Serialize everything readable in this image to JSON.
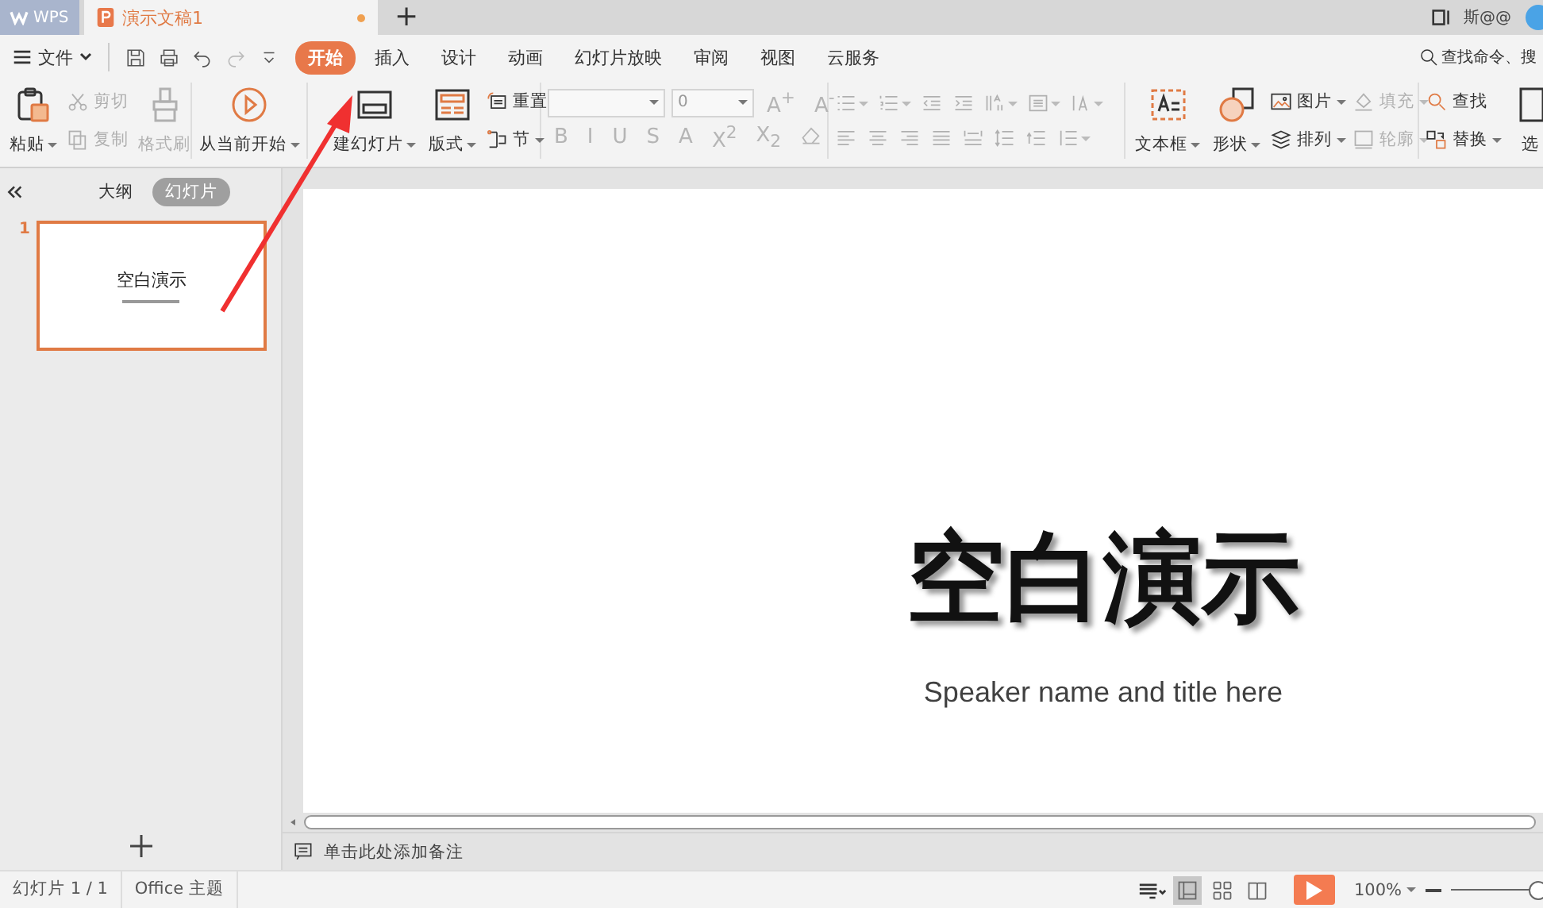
{
  "title_bar": {
    "app_tab": "WPS",
    "document_tab": {
      "title": "演示文稿1",
      "unsaved": true
    },
    "new_tab": "+",
    "user": "斯@@"
  },
  "menu_bar": {
    "file_menu": "文件",
    "quick_access": [
      {
        "disabled": false
      },
      {
        "disabled": false
      },
      {
        "disabled": false
      },
      {
        "disabled": true
      },
      {
        "disabled": false
      }
    ],
    "tabs": [
      {
        "label": "开始",
        "selected": true
      },
      {
        "label": "插入",
        "selected": false
      },
      {
        "label": "设计",
        "selected": false
      },
      {
        "label": "动画",
        "selected": false
      },
      {
        "label": "幻灯片放映",
        "selected": false
      },
      {
        "label": "审阅",
        "selected": false
      },
      {
        "label": "视图",
        "selected": false
      },
      {
        "label": "云服务",
        "selected": false
      }
    ],
    "search": {
      "placeholder": "查找命令、搜"
    }
  },
  "ribbon": {
    "groups": [
      {
        "items": [
          {
            "kind": "large",
            "label": "粘贴",
            "dropdown": true,
            "disabled": false
          },
          {
            "kind": "stack",
            "items": [
              {
                "label": "剪切",
                "dropdown": false,
                "disabled": true
              },
              {
                "label": "复制",
                "dropdown": false,
                "disabled": true
              }
            ]
          },
          {
            "kind": "large",
            "label": "格式刷",
            "dropdown": false,
            "disabled": true
          }
        ]
      },
      {
        "items": [
          {
            "kind": "large",
            "label": "从当前开始",
            "dropdown": true,
            "disabled": false
          }
        ]
      },
      {
        "items": [
          {
            "kind": "large",
            "label": "建幻灯片",
            "dropdown": true,
            "disabled": false
          },
          {
            "kind": "large",
            "label": "版式",
            "dropdown": true,
            "disabled": false
          },
          {
            "kind": "stack",
            "items": [
              {
                "label": "重置",
                "dropdown": false,
                "disabled": false
              },
              {
                "label": "节",
                "dropdown": true,
                "disabled": false
              }
            ]
          }
        ]
      },
      {
        "items": [
          {
            "kind": "font",
            "disabled": true,
            "size": "0",
            "size_buttons": [
              "A$^{+}$",
              "A$^{-}$"
            ],
            "format_buttons": [
              "B",
              "I",
              "U",
              "S",
              "A",
              "X$^{2}$",
              "X$_{2}$"
            ]
          }
        ]
      },
      {
        "items": [
          {
            "kind": "paragraph",
            "disabled": true
          }
        ]
      },
      {
        "items": [
          {
            "kind": "large",
            "label": "文本框",
            "dropdown": true,
            "disabled": false
          },
          {
            "kind": "large",
            "label": "形状",
            "dropdown": true,
            "disabled": false
          },
          {
            "kind": "stack",
            "items": [
              {
                "label": "图片",
                "dropdown": true,
                "disabled": false
              },
              {
                "label": "排列",
                "dropdown": true,
                "disabled": false
              }
            ]
          },
          {
            "kind": "stack",
            "items": [
              {
                "label": "填充",
                "dropdown": true,
                "disabled": true
              },
              {
                "label": "轮廓",
                "dropdown": true,
                "disabled": true
              }
            ]
          }
        ]
      },
      {
        "items": [
          {
            "kind": "stack",
            "items": [
              {
                "label": "查找",
                "dropdown": false,
                "disabled": false
              },
              {
                "label": "替换",
                "dropdown": true,
                "disabled": false
              }
            ]
          },
          {
            "kind": "large",
            "label": "选",
            "dropdown": false,
            "disabled": false
          }
        ]
      }
    ]
  },
  "slide_panel": {
    "tabs": [
      {
        "label": "大纲",
        "selected": false
      },
      {
        "label": "幻灯片",
        "selected": true
      }
    ],
    "slides": [
      {
        "number": "1",
        "title": "空白演示",
        "selected": true
      }
    ]
  },
  "slide": {
    "title": "空白演示",
    "subtitle": "Speaker name and title here"
  },
  "notes": {
    "placeholder": "单击此处添加备注"
  },
  "status_bar": {
    "slide_count": "幻灯片 1 / 1",
    "theme": "Office 主题",
    "views": [
      {
        "selected": true
      },
      {
        "selected": false
      },
      {
        "selected": false
      }
    ],
    "zoom": {
      "value": "100%",
      "level": 0.95
    }
  }
}
